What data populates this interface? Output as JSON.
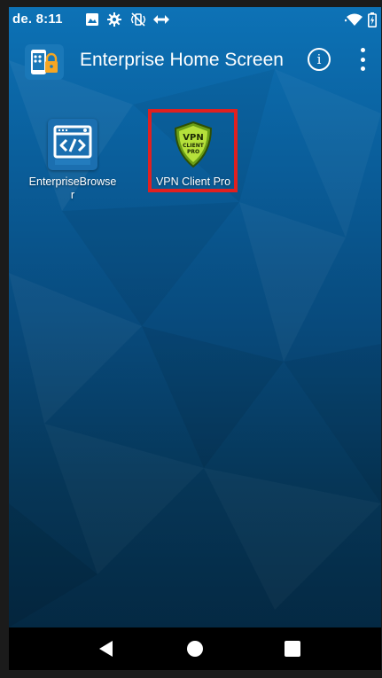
{
  "status_bar": {
    "time": "de. 8:11",
    "left_icons": [
      "image-icon",
      "gear-icon",
      "vibrate-mute-icon",
      "data-sync-icon"
    ],
    "right_icons": [
      "wifi-icon",
      "battery-icon"
    ]
  },
  "app_bar": {
    "title": "Enterprise Home Screen",
    "logo_icon": "phone-lock-icon",
    "info_icon": "info-icon",
    "info_glyph": "i",
    "menu_icon": "more-vert-icon"
  },
  "apps": [
    {
      "label": "EnterpriseBrowser",
      "icon": "code-browser-icon"
    },
    {
      "label": "VPN Client Pro",
      "icon": "vpn-shield-icon",
      "icon_text": [
        "VPN",
        "CLIENT",
        "PRO"
      ],
      "highlighted": true
    }
  ],
  "nav_bar": {
    "buttons": [
      "back-icon",
      "home-icon",
      "recents-icon"
    ]
  },
  "colors": {
    "wallpaper_top": "#0d72b6",
    "wallpaper_bottom": "#04253d",
    "highlight": "#e02020",
    "shield_green": "#9acd32",
    "nav_background": "#000000"
  }
}
